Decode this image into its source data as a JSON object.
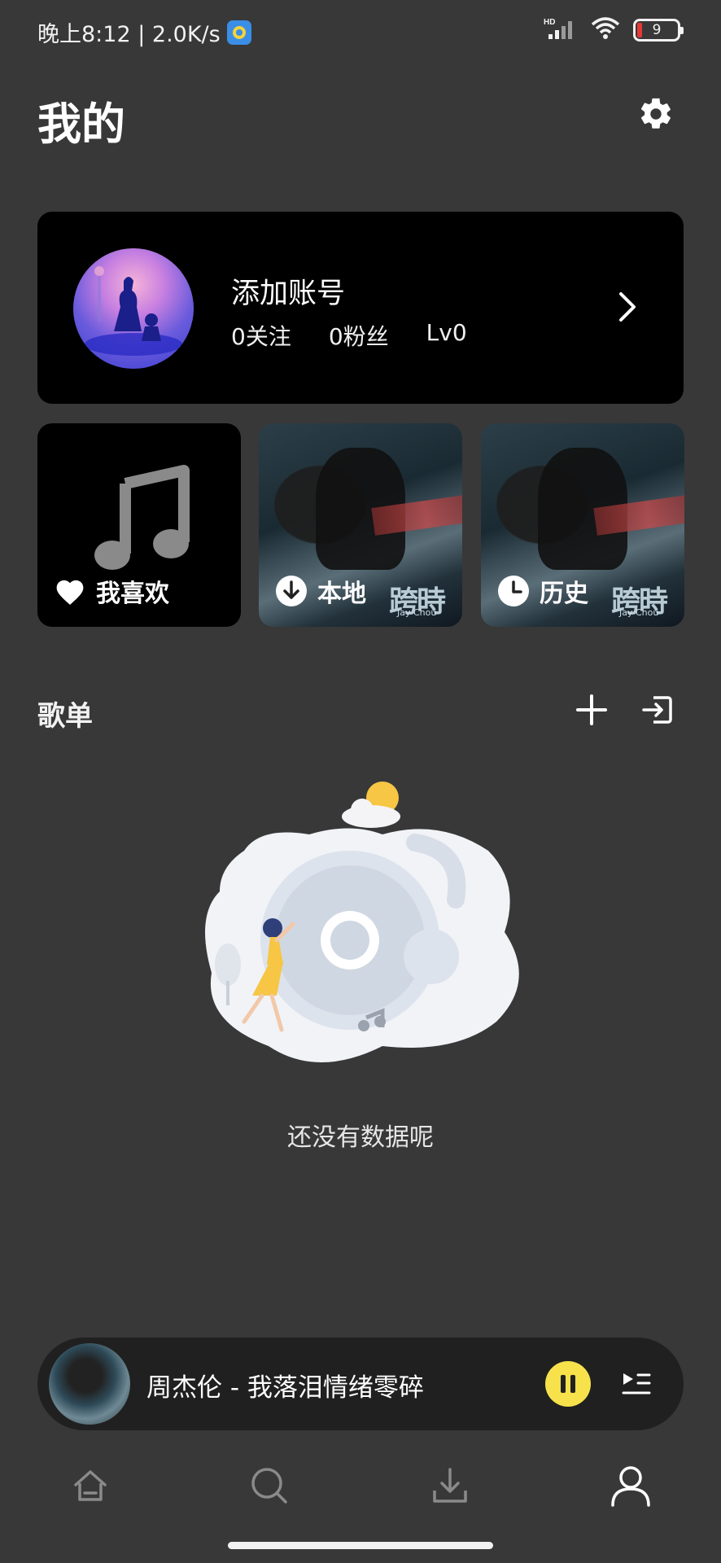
{
  "status_bar": {
    "time_speed": "晚上8:12 | 2.0K/s",
    "network_label": "HD",
    "battery_level": "9"
  },
  "header": {
    "title": "我的"
  },
  "account": {
    "name": "添加账号",
    "stats": [
      "0关注",
      "0粉丝",
      "Lv0"
    ]
  },
  "tiles": [
    {
      "label": "我喜欢",
      "icon": "heart-icon"
    },
    {
      "label": "本地",
      "icon": "download-icon",
      "cover_text": "跨時代",
      "cover_sub": "Jay Chou"
    },
    {
      "label": "历史",
      "icon": "clock-icon",
      "cover_text": "跨時代",
      "cover_sub": "Jay Chou"
    }
  ],
  "playlist_section": {
    "title": "歌单",
    "empty_text": "还没有数据呢"
  },
  "mini_player": {
    "title": "周杰伦 - 我落泪情绪零碎",
    "accent_color": "#f7e24b"
  },
  "bottom_nav": {
    "items": [
      "home-icon",
      "search-icon",
      "download-icon",
      "user-icon"
    ],
    "active": "user-icon"
  }
}
